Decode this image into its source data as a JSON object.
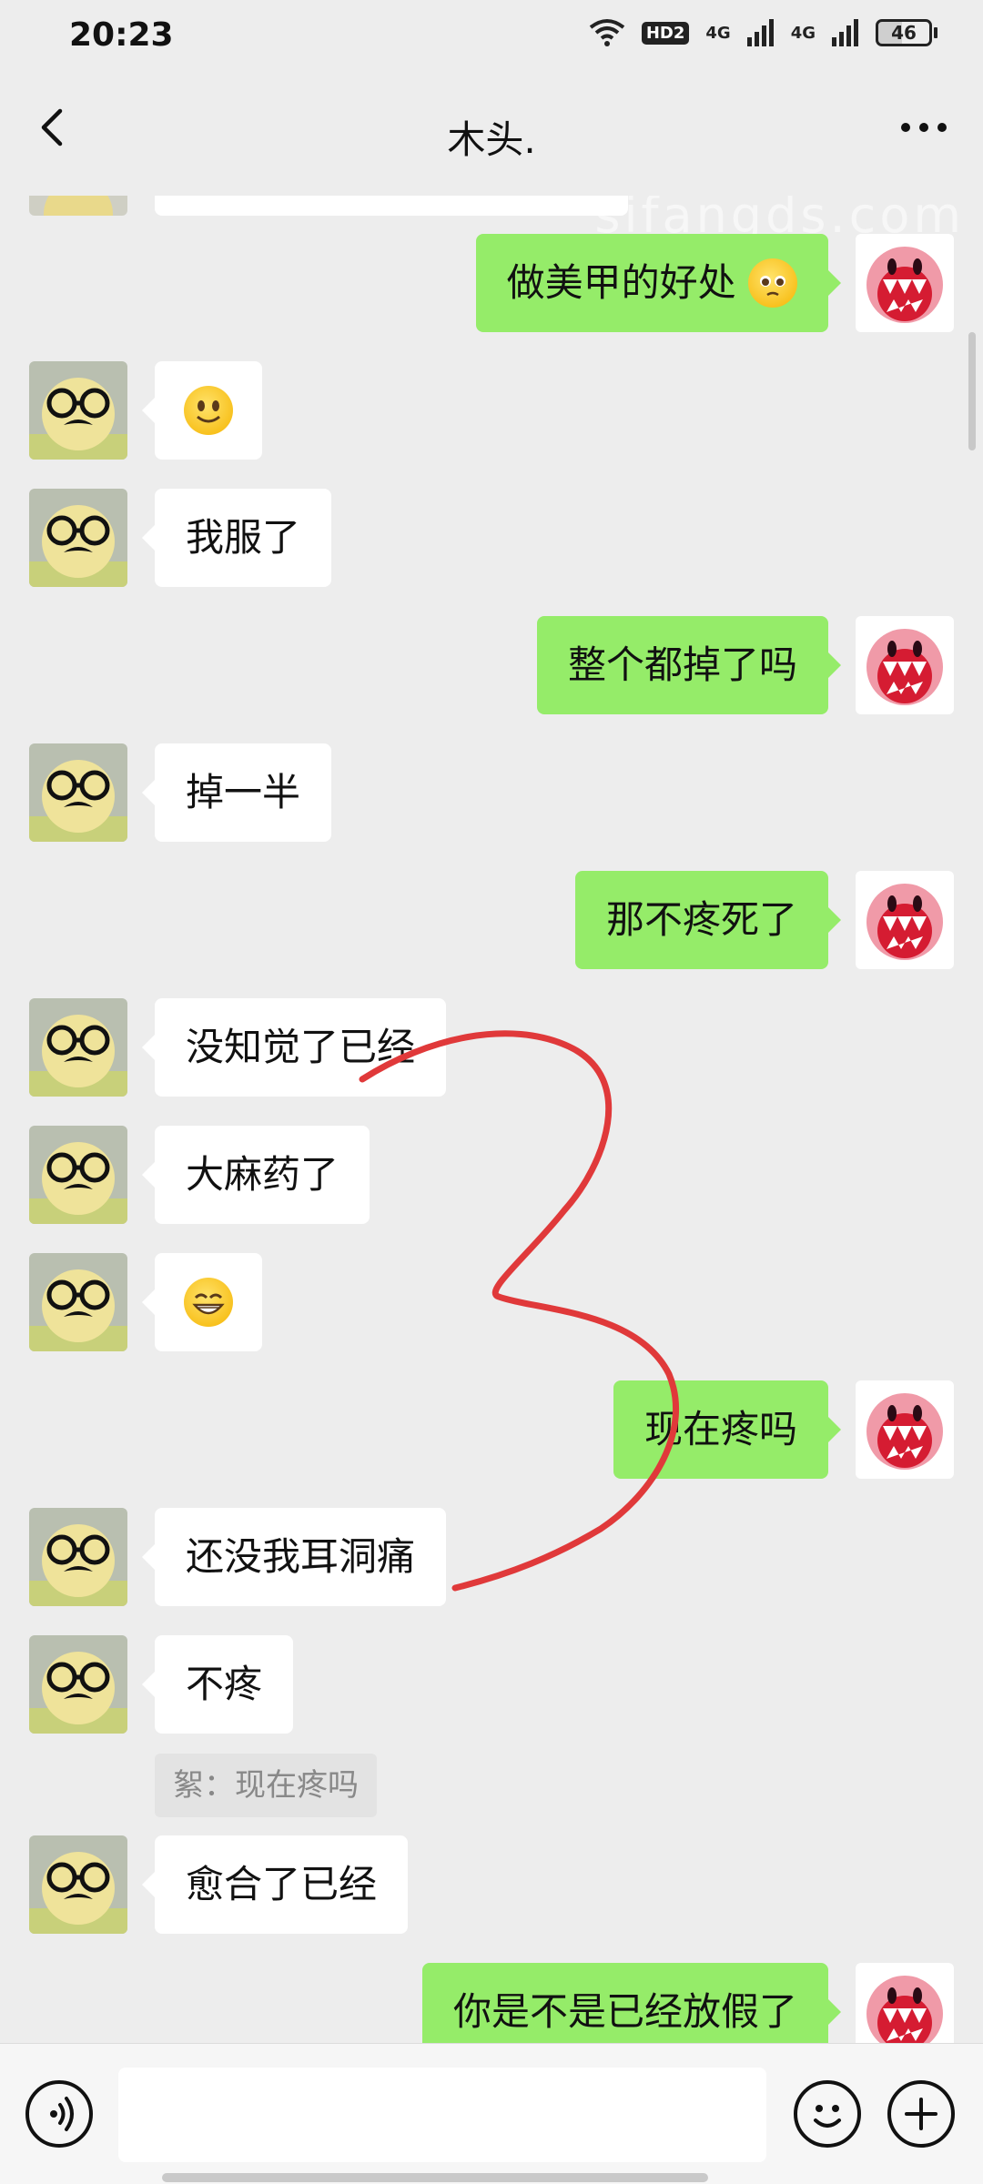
{
  "status_bar": {
    "time": "20:23",
    "hd": "HD2",
    "net1": "4G",
    "net2": "4G",
    "battery": "46"
  },
  "header": {
    "title": "木头."
  },
  "watermark": "sifangds.com",
  "messages": [
    {
      "side": "right",
      "text": "做美甲的好处",
      "emoji": "pleading-face"
    },
    {
      "side": "left",
      "text": "",
      "emoji": "smile-face"
    },
    {
      "side": "left",
      "text": "我服了"
    },
    {
      "side": "right",
      "text": "整个都掉了吗"
    },
    {
      "side": "left",
      "text": "掉一半"
    },
    {
      "side": "right",
      "text": "那不疼死了"
    },
    {
      "side": "left",
      "text": "没知觉了已经"
    },
    {
      "side": "left",
      "text": "大麻药了"
    },
    {
      "side": "left",
      "text": "",
      "emoji": "grin-face"
    },
    {
      "side": "right",
      "text": "现在疼吗"
    },
    {
      "side": "left",
      "text": "还没我耳洞痛"
    },
    {
      "side": "left",
      "text": "不疼",
      "quote": "絮：现在疼吗"
    },
    {
      "side": "left",
      "text": "愈合了已经"
    },
    {
      "side": "right",
      "text": "你是不是已经放假了"
    }
  ],
  "colors": {
    "background": "#ededed",
    "self_bubble": "#95ec69",
    "other_bubble": "#ffffff",
    "annotation": "#e0393a"
  },
  "icons": {
    "back": "chevron-left-icon",
    "more": "more-dots-icon",
    "voice": "voice-icon",
    "sticker": "emoji-icon",
    "plus": "plus-icon"
  }
}
